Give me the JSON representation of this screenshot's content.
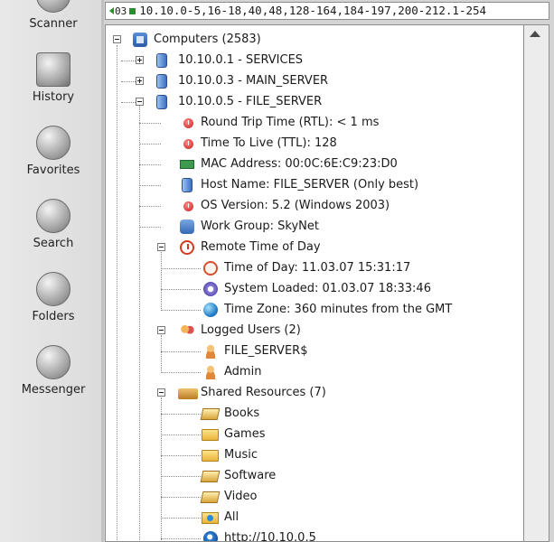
{
  "sidebar": {
    "items": [
      {
        "label": "Scanner",
        "icon": "scanner-icon"
      },
      {
        "label": "History",
        "icon": "history-icon"
      },
      {
        "label": "Favorites",
        "icon": "favorites-icon"
      },
      {
        "label": "Search",
        "icon": "search-icon"
      },
      {
        "label": "Folders",
        "icon": "folders-icon"
      },
      {
        "label": "Messenger",
        "icon": "messenger-icon"
      }
    ]
  },
  "range": {
    "prefix": "03",
    "value": "10.10.0-5,16-18,40,48,128-164,184-197,200-212.1-254"
  },
  "tree": {
    "root": "Computers (2583)",
    "host1": "10.10.0.1 - SERVICES",
    "host2": "10.10.0.3 - MAIN_SERVER",
    "host3": "10.10.0.5 - FILE_SERVER",
    "rtt": "Round Trip Time (RTL): < 1 ms",
    "ttl": "Time To Live (TTL): 128",
    "mac": "MAC Address: 00:0C:6E:C9:23:D0",
    "hostname": "Host Name: FILE_SERVER (Only best)",
    "os": "OS Version: 5.2 (Windows 2003)",
    "workgroup": "Work Group: SkyNet",
    "remote_time": "Remote Time of Day",
    "time_of_day": "Time of Day: 11.03.07 15:31:17",
    "system_loaded": "System Loaded: 01.03.07 18:33:46",
    "time_zone": "Time Zone: 360 minutes from the GMT",
    "logged_users": "Logged Users (2)",
    "user1": "FILE_SERVER$",
    "user2": "Admin",
    "shared": "Shared Resources (7)",
    "share_books": "Books",
    "share_games": "Games",
    "share_music": "Music",
    "share_software": "Software",
    "share_video": "Video",
    "share_all": "All",
    "share_http": "http://10.10.0.5"
  }
}
